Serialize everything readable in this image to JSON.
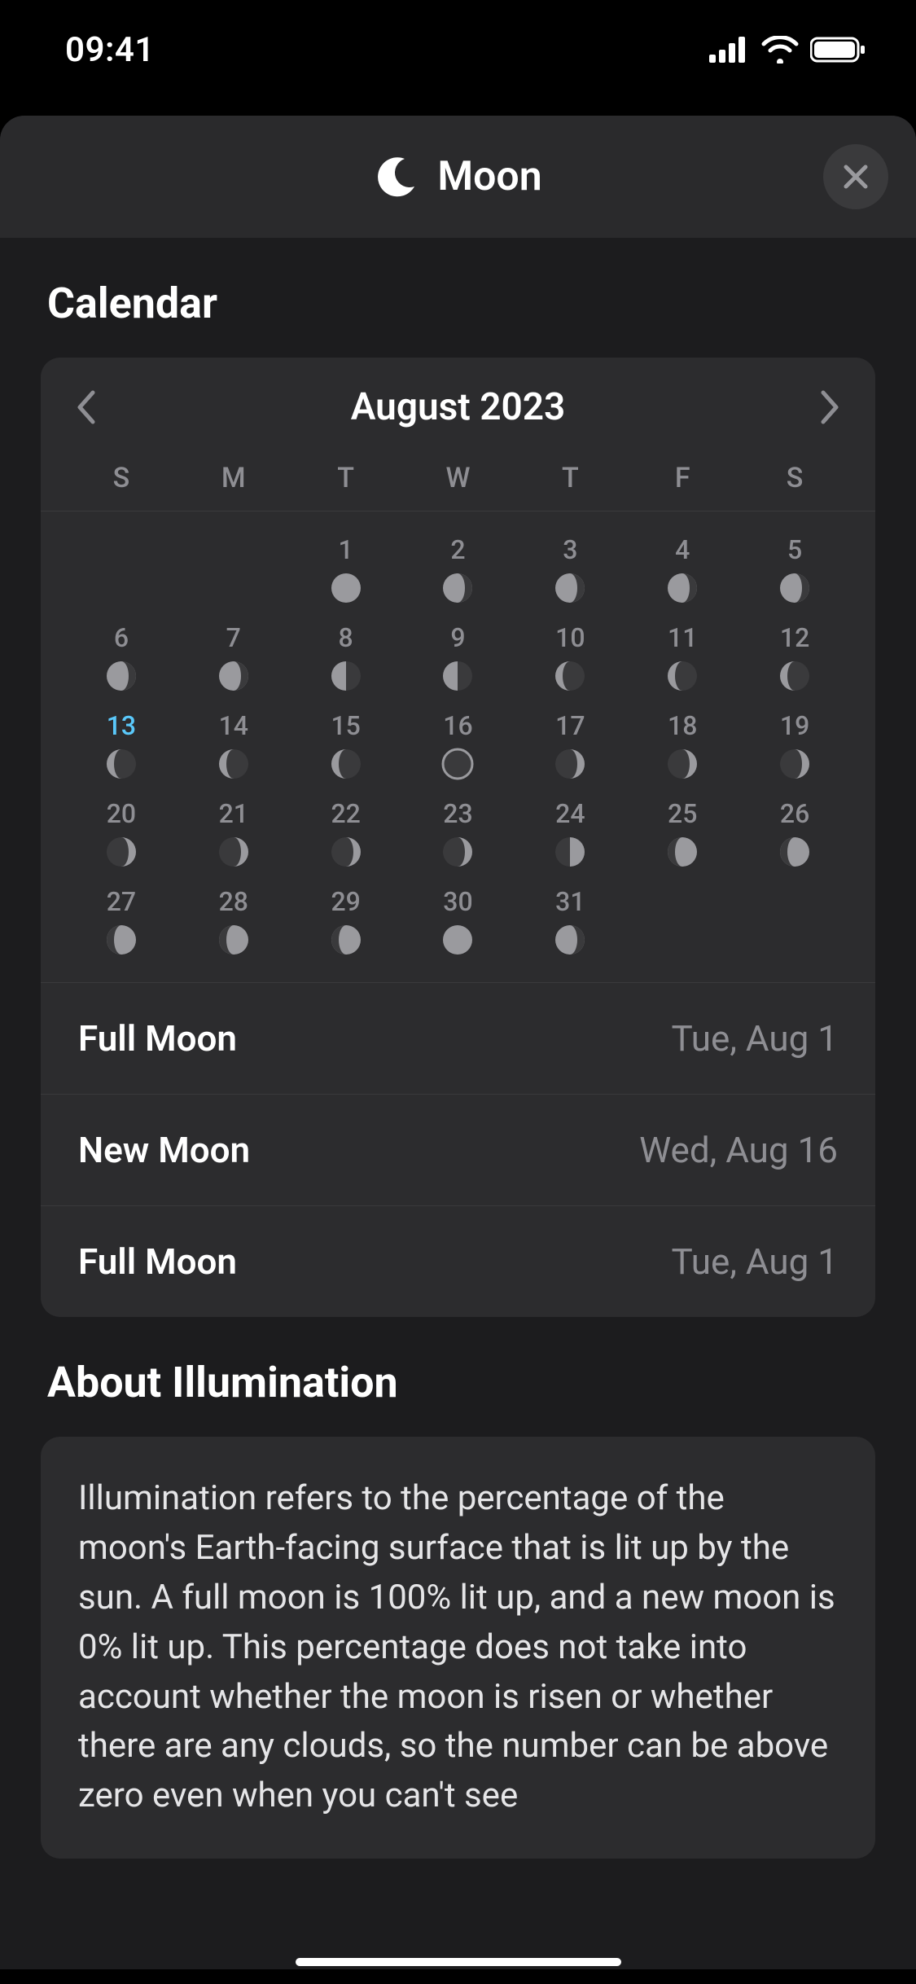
{
  "status": {
    "time": "09:41"
  },
  "sheet": {
    "title": "Moon",
    "calendar_heading": "Calendar",
    "month_label": "August 2023",
    "weekdays": [
      "S",
      "M",
      "T",
      "W",
      "T",
      "F",
      "S"
    ],
    "selected_day": 13,
    "days": [
      {
        "n": null
      },
      {
        "n": null
      },
      {
        "n": 1,
        "phase": "full"
      },
      {
        "n": 2,
        "phase": "waning_gibbous"
      },
      {
        "n": 3,
        "phase": "waning_gibbous"
      },
      {
        "n": 4,
        "phase": "waning_gibbous"
      },
      {
        "n": 5,
        "phase": "waning_gibbous"
      },
      {
        "n": 6,
        "phase": "waning_gibbous"
      },
      {
        "n": 7,
        "phase": "waning_gibbous"
      },
      {
        "n": 8,
        "phase": "last_quarter"
      },
      {
        "n": 9,
        "phase": "last_quarter"
      },
      {
        "n": 10,
        "phase": "waning_crescent"
      },
      {
        "n": 11,
        "phase": "waning_crescent"
      },
      {
        "n": 12,
        "phase": "waning_crescent"
      },
      {
        "n": 13,
        "phase": "waning_crescent"
      },
      {
        "n": 14,
        "phase": "waning_crescent"
      },
      {
        "n": 15,
        "phase": "waning_crescent"
      },
      {
        "n": 16,
        "phase": "new"
      },
      {
        "n": 17,
        "phase": "waxing_crescent"
      },
      {
        "n": 18,
        "phase": "waxing_crescent"
      },
      {
        "n": 19,
        "phase": "waxing_crescent"
      },
      {
        "n": 20,
        "phase": "waxing_crescent"
      },
      {
        "n": 21,
        "phase": "waxing_crescent"
      },
      {
        "n": 22,
        "phase": "waxing_crescent"
      },
      {
        "n": 23,
        "phase": "waxing_crescent"
      },
      {
        "n": 24,
        "phase": "first_quarter"
      },
      {
        "n": 25,
        "phase": "waxing_gibbous"
      },
      {
        "n": 26,
        "phase": "waxing_gibbous"
      },
      {
        "n": 27,
        "phase": "waxing_gibbous"
      },
      {
        "n": 28,
        "phase": "waxing_gibbous"
      },
      {
        "n": 29,
        "phase": "waxing_gibbous"
      },
      {
        "n": 30,
        "phase": "full"
      },
      {
        "n": 31,
        "phase": "waning_gibbous"
      },
      {
        "n": null
      },
      {
        "n": null
      }
    ],
    "events": [
      {
        "label": "Full Moon",
        "date": "Tue, Aug 1"
      },
      {
        "label": "New Moon",
        "date": "Wed, Aug 16"
      },
      {
        "label": "Full Moon",
        "date": "Tue, Aug 1"
      }
    ],
    "about_heading": "About Illumination",
    "about_text": "Illumination refers to the percentage of the moon's Earth-facing surface that is lit up by the sun. A full moon is 100% lit up, and a new moon is 0% lit up. This percentage does not take into account whether the moon is risen or whether there are any clouds, so the number can be above zero even when you can't see"
  }
}
